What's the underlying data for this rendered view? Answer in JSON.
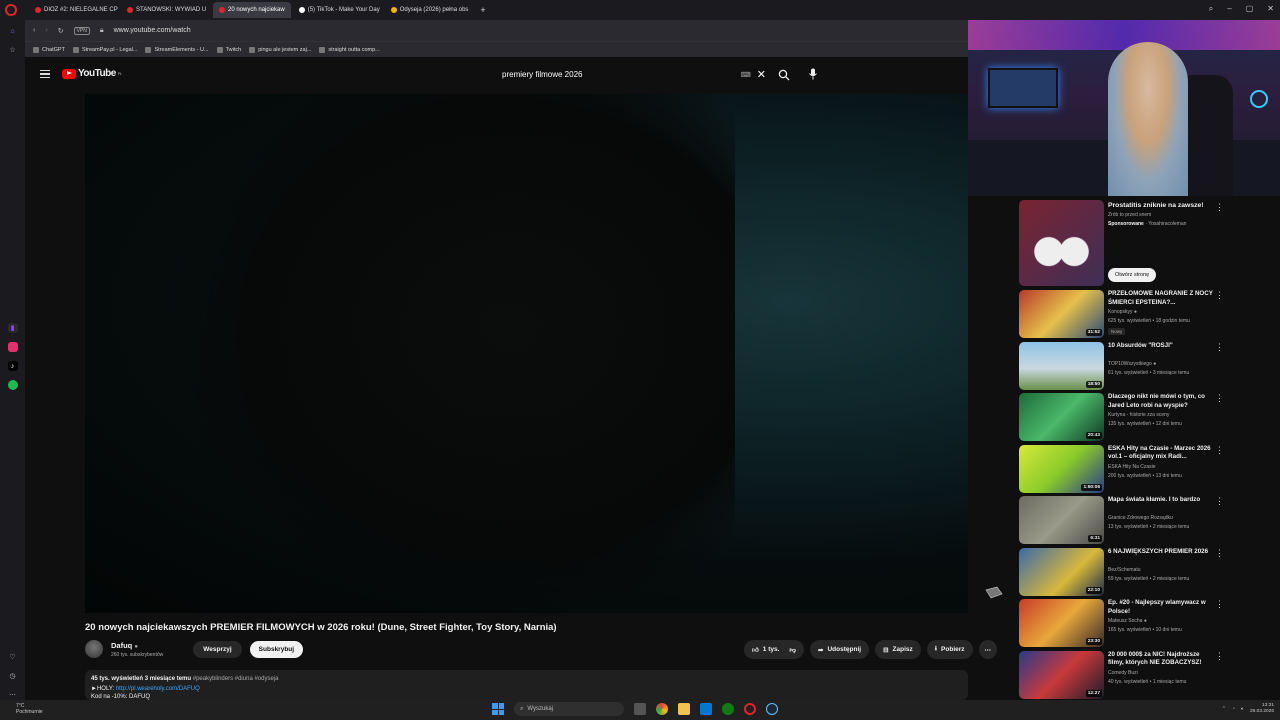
{
  "browser": {
    "tabs": [
      {
        "label": "DIOZ #2: NIELEGALNE CP",
        "color": "#e0262a",
        "active": false
      },
      {
        "label": "STANOWSKI: WYWIAD U",
        "color": "#e0262a",
        "active": false
      },
      {
        "label": "20 nowych najciekaw",
        "color": "#e0262a",
        "active": true
      },
      {
        "label": "(5) TikTok - Make Your Day",
        "color": "#ffffff",
        "active": false
      },
      {
        "label": "Odyseja (2026) pełna obs",
        "color": "#f5b400",
        "active": false
      }
    ],
    "new_tab": "+",
    "url": "www.youtube.com/watch",
    "vpn_label": "VPN",
    "bookmarks": [
      "ChatGPT",
      "StreamPay.pl - Legal...",
      "StreamElements - U...",
      "Twitch",
      "pingu ale jestem zaj...",
      "straight outta comp..."
    ]
  },
  "youtube": {
    "logo_text": "YouTube",
    "logo_country": "PL",
    "search_query": "premiery filmowe 2026",
    "clear_symbol": "✕"
  },
  "video": {
    "title": "20 nowych najciekawszych PREMIER FILMOWYCH w 2026 roku! (Dune, Street Fighter, Toy Story, Narnia)",
    "channel": "Dafuq",
    "subscribers": "260 tys. subskrybentów",
    "support_label": "Wesprzyj",
    "subscribe_label": "Subskrybuj",
    "likes": "1 tys.",
    "share_label": "Udostępnij",
    "save_label": "Zapisz",
    "download_label": "Pobierz",
    "views_date": "45 tys. wyświetleń  3 miesiące temu",
    "tags": "#peakyblinders #diuna #odyseja",
    "desc_line1_prefix": "►HOLY: ",
    "desc_link": "http://pl.weareholy.com/DAFUQ",
    "desc_line2": "Kod na -10%: DAFUQ"
  },
  "ad": {
    "title": "Prostatitis zniknie na zawsze!",
    "subtitle": "Zrób to przed snem",
    "sponsored": "Sponsorowane",
    "advertiser": "Yosahiracoleman",
    "open_label": "Otwórz stronę"
  },
  "recommendations": [
    {
      "title": "PRZEŁOMOWE NAGRANIE Z NOCY ŚMIERCI EPSTEINA?...",
      "channel": "Konopskyy",
      "meta": "625 tys. wyświetleń • 18 godzin temu",
      "duration": "31:52",
      "badge": "Nowy",
      "thumb": "linear-gradient(135deg,#b83a2a,#e6c04a 50%,#2a4a7a)",
      "verified": true
    },
    {
      "title": "10 Absurdów \"ROSJI\"",
      "channel": "TOP10Wszystkiego",
      "meta": "61 tys. wyświetleń • 3 miesiące temu",
      "duration": "18:50",
      "badge": "",
      "thumb": "linear-gradient(180deg,#8fc3e6,#c9d8e0 55%,#6a8f4a)",
      "verified": true
    },
    {
      "title": "Dlaczego nikt nie mówi o tym, co Jared Leto robi na wyspie?",
      "channel": "Kurtyna - historie zza sceny",
      "meta": "135 tys. wyświetleń • 12 dni temu",
      "duration": "20:43",
      "badge": "",
      "thumb": "linear-gradient(135deg,#1e6a3a,#4ab86a 50%,#0e3a22)",
      "verified": false
    },
    {
      "title": "ESKA Hity na Czasie - Marzec 2026 vol.1 – oficjalny mix Radi...",
      "channel": "ESKA Hity Na Czasie",
      "meta": "200 tys. wyświetleń • 13 dni temu",
      "duration": "1:50:06",
      "badge": "",
      "thumb": "linear-gradient(135deg,#d9e83a,#8acb2a 50%,#2a3a8a)",
      "verified": false
    },
    {
      "title": "Mapa świata kłamie. I to bardzo",
      "channel": "Granice Zdrowego Rozsądku",
      "meta": "13 tys. wyświetleń • 2 miesiące temu",
      "duration": "6:31",
      "badge": "",
      "thumb": "linear-gradient(135deg,#6a6a60,#9a9a8a 50%,#4a4a44)",
      "verified": false
    },
    {
      "title": "6 NAJWIĘKSZYCH PREMIER 2026",
      "channel": "Bez/Schematu",
      "meta": "59 tys. wyświetleń • 2 miesiące temu",
      "duration": "22:10",
      "badge": "",
      "thumb": "linear-gradient(135deg,#3a6aa8,#d8b83a 60%,#1a2a4a)",
      "verified": false
    },
    {
      "title": "Ep. #20 - Najlepszy wlamywacz w Polsce!",
      "channel": "Mateusz Socha",
      "meta": "165 tys. wyświetleń • 10 dni temu",
      "duration": "23:30",
      "badge": "",
      "thumb": "linear-gradient(135deg,#c83a2a,#e8a83a 50%,#3a2a2a)",
      "verified": true
    },
    {
      "title": "20 000 000$ za NIC! Najdroższe filmy, których NIE ZOBACZYSZ!",
      "channel": "Comedy Buzi",
      "meta": "40 tys. wyświetleń • 1 miesiąc temu",
      "duration": "12:27",
      "badge": "",
      "thumb": "linear-gradient(135deg,#2a3a8a,#c83a3a 50%,#1a1a2a)",
      "verified": false
    }
  ],
  "taskbar": {
    "weather_temp": "7°C",
    "weather_desc": "Pochmurnie",
    "search_placeholder": "Wyszukaj",
    "time": "13:31",
    "date": "26.03.2026"
  }
}
